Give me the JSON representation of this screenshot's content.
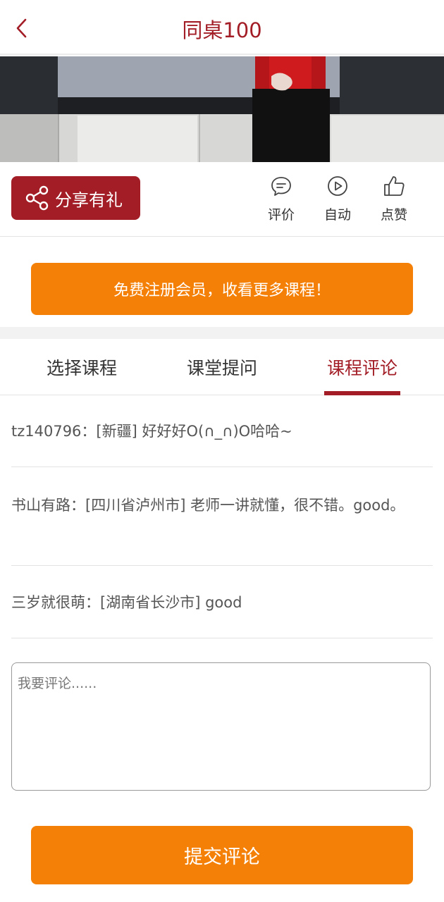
{
  "header": {
    "title": "同桌100",
    "back_icon": "chevron-left-icon"
  },
  "video": {
    "description_icon": "video-frame"
  },
  "actions": {
    "share_label": "分享有礼",
    "share_icon": "share-icon",
    "items": [
      {
        "label": "评价",
        "icon": "comment-bubble-icon"
      },
      {
        "label": "自动",
        "icon": "play-circle-icon"
      },
      {
        "label": "点赞",
        "icon": "thumbs-up-icon"
      }
    ]
  },
  "register": {
    "label": "免费注册会员，收看更多课程！"
  },
  "tabs": [
    {
      "label": "选择课程",
      "active": false
    },
    {
      "label": "课堂提问",
      "active": false
    },
    {
      "label": "课程评论",
      "active": true
    }
  ],
  "comments": [
    {
      "user": "tz140796：",
      "location": "[新疆]",
      "text": "好好好O(∩_∩)O哈哈~"
    },
    {
      "user": "书山有路：",
      "location": "[四川省泸州市]",
      "text": "老师一讲就懂，很不错。good。"
    },
    {
      "user": "三岁就很萌：",
      "location": "[湖南省长沙市]",
      "text": "good"
    }
  ],
  "comment_input": {
    "placeholder": "我要评论......",
    "value": ""
  },
  "submit": {
    "label": "提交评论"
  },
  "colors": {
    "brand_red": "#a21d26",
    "orange": "#f48007",
    "divider": "#e3e3e3"
  }
}
